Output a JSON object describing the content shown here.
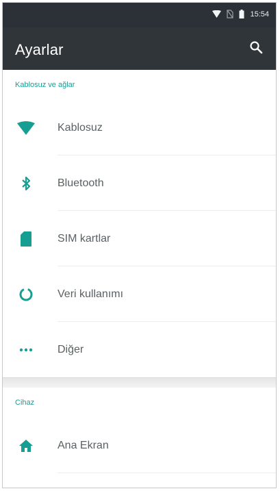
{
  "statusbar": {
    "time": "15:54",
    "icons": [
      "wifi-signal-icon",
      "no-sim-icon",
      "battery-icon"
    ]
  },
  "toolbar": {
    "title": "Ayarlar",
    "search_icon": "search-icon"
  },
  "sections": [
    {
      "header": "Kablosuz ve ağlar",
      "items": [
        {
          "label": "Kablosuz",
          "icon": "wifi-icon"
        },
        {
          "label": "Bluetooth",
          "icon": "bluetooth-icon"
        },
        {
          "label": "SIM kartlar",
          "icon": "sim-card-icon"
        },
        {
          "label": "Veri kullanımı",
          "icon": "data-usage-icon"
        },
        {
          "label": "Diğer",
          "icon": "more-icon"
        }
      ]
    },
    {
      "header": "Cihaz",
      "items": [
        {
          "label": "Ana Ekran",
          "icon": "home-icon"
        }
      ]
    }
  ],
  "colors": {
    "accent": "#179e92",
    "toolbar": "#2f3539",
    "statusbar": "#2b3136"
  }
}
